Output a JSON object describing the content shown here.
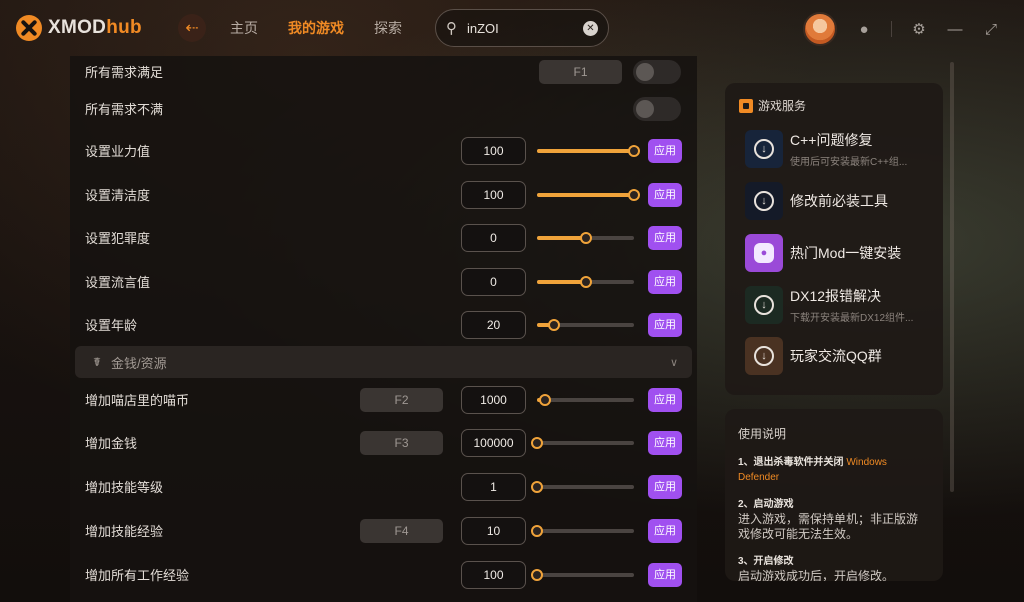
{
  "app": {
    "name_a": "XMOD",
    "name_b": "hub"
  },
  "nav": {
    "items": [
      "主页",
      "我的游戏",
      "探索"
    ],
    "active": 1
  },
  "search": {
    "value": "inZOI"
  },
  "rows_top": [
    {
      "label": "所有需求满足",
      "hotkey": "F1",
      "type": "toggle"
    },
    {
      "label": "所有需求不满",
      "type": "toggle"
    },
    {
      "label": "设置业力值",
      "value": "100",
      "level": 1.0,
      "apply": "应用"
    },
    {
      "label": "设置清洁度",
      "value": "100",
      "level": 1.0,
      "apply": "应用"
    },
    {
      "label": "设置犯罪度",
      "value": "0",
      "level": 0.5,
      "apply": "应用"
    },
    {
      "label": "设置流言值",
      "value": "0",
      "level": 0.5,
      "apply": "应用"
    },
    {
      "label": "设置年龄",
      "value": "20",
      "level": 0.18,
      "apply": "应用"
    }
  ],
  "section": {
    "label": "金钱/资源"
  },
  "rows_money": [
    {
      "label": "增加喵店里的喵币",
      "hotkey": "F2",
      "value": "1000",
      "level": 0.08,
      "apply": "应用"
    },
    {
      "label": "增加金钱",
      "hotkey": "F3",
      "value": "100000",
      "level": 0.0,
      "apply": "应用"
    },
    {
      "label": "增加技能等级",
      "value": "1",
      "level": 0.0,
      "apply": "应用"
    },
    {
      "label": "增加技能经验",
      "hotkey": "F4",
      "value": "10",
      "level": 0.0,
      "apply": "应用"
    },
    {
      "label": "增加所有工作经验",
      "value": "100",
      "level": 0.0,
      "apply": "应用"
    }
  ],
  "services": {
    "title": "游戏服务",
    "items": [
      {
        "name": "C++问题修复",
        "sub": "使用后可安装最新C++组...",
        "icon": "download-icon",
        "bg": "#17243a"
      },
      {
        "name": "修改前必装工具",
        "sub": "",
        "icon": "download-icon",
        "bg": "#141a28"
      },
      {
        "name": "热门Mod一键安装",
        "sub": "",
        "icon": "mod-icon",
        "bg": "#9a4ad8"
      },
      {
        "name": "DX12报错解决",
        "sub": "下载开安装最新DX12组件...",
        "icon": "download-icon",
        "bg": "#1c2a22"
      },
      {
        "name": "玩家交流QQ群",
        "sub": "",
        "icon": "download-icon",
        "bg": "#4a3222"
      }
    ]
  },
  "instructions": {
    "title": "使用说明",
    "step1_head": "1、退出杀毒软件并关闭",
    "step1_hl": "Windows Defender",
    "step2_head": "2、启动游戏",
    "step2_body": "进入游戏，需保持单机；非正版游戏修改可能无法生效。",
    "step3_head": "3、开启修改",
    "step3_body": "启动游戏成功后，开启修改。"
  },
  "colors": {
    "accent": "#f08a24",
    "apply": "#a050f0",
    "slider": "#f0a33a"
  }
}
